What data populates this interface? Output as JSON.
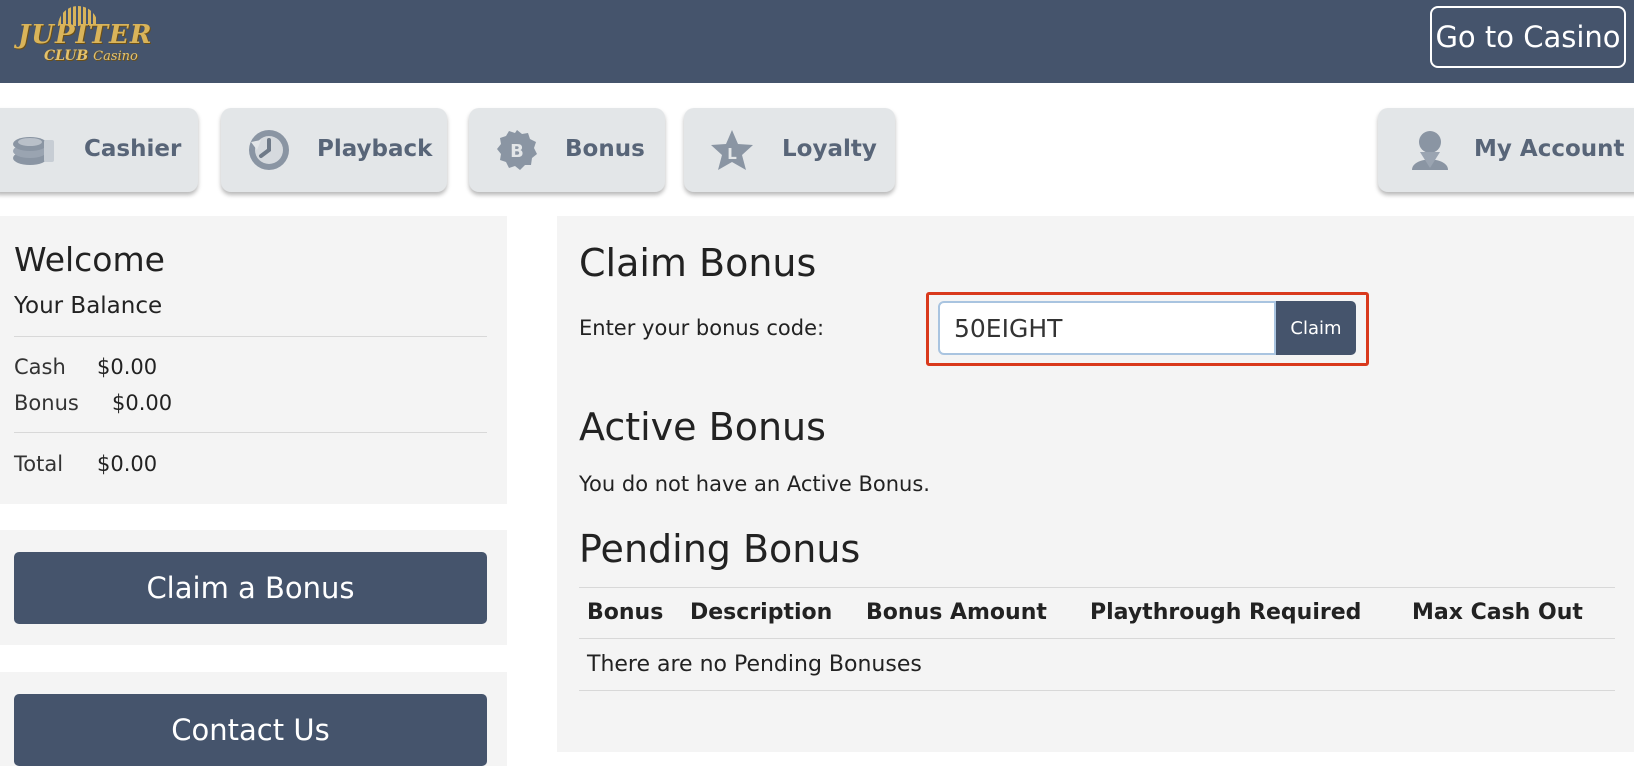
{
  "header": {
    "logo_top": "JUPITER",
    "logo_club": "CLUB",
    "logo_script": "Casino",
    "go_casino_label": "Go to Casino"
  },
  "nav": {
    "items": [
      {
        "label": "Cashier",
        "icon": "coins-icon"
      },
      {
        "label": "Playback",
        "icon": "history-icon"
      },
      {
        "label": "Bonus",
        "icon": "bonus-badge-icon"
      },
      {
        "label": "Loyalty",
        "icon": "star-icon"
      },
      {
        "label": "My Account",
        "icon": "user-icon"
      }
    ]
  },
  "sidebar": {
    "welcome": "Welcome",
    "balance_title": "Your Balance",
    "cash_label": "Cash",
    "cash_value": "$0.00",
    "bonus_label": "Bonus",
    "bonus_value": "$0.00",
    "total_label": "Total",
    "total_value": "$0.00",
    "claim_bonus_label": "Claim a Bonus",
    "contact_us_label": "Contact Us"
  },
  "main": {
    "claim_title": "Claim Bonus",
    "code_label": "Enter your bonus code:",
    "code_value": "50EIGHT",
    "claim_button_label": "Claim",
    "active_title": "Active Bonus",
    "active_text": "You do not have an Active Bonus.",
    "pending_title": "Pending Bonus",
    "pending_columns": [
      "Bonus",
      "Description",
      "Bonus Amount",
      "Playthrough Required",
      "Max Cash Out"
    ],
    "pending_empty": "There are no Pending Bonuses"
  },
  "colors": {
    "header_bg": "#45546c",
    "primary_button": "#45546c",
    "highlight_border": "#d9391c"
  }
}
